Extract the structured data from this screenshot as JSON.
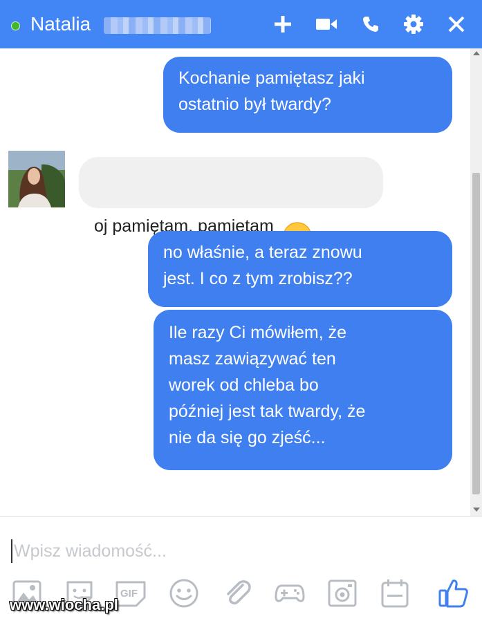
{
  "header": {
    "contact_name": "Natalia",
    "status": "online",
    "accent_color": "#4285f4",
    "icons": [
      "add-icon",
      "video-call-icon",
      "phone-icon",
      "gear-icon",
      "close-icon"
    ]
  },
  "messages": [
    {
      "direction": "outgoing",
      "text": "Kochanie pamiętasz jaki\nostatnio był twardy?"
    },
    {
      "direction": "incoming",
      "text": "oj pamiętam, pamiętam",
      "emoji": "smiling-face"
    },
    {
      "direction": "outgoing",
      "text": "no właśnie, a teraz znowu\njest. I co z tym zrobisz??"
    },
    {
      "direction": "outgoing",
      "text": "Ile razy Ci mówiłem, że\nmasz zawiązywać ten\nworek od chleba bo\npóźniej jest tak twardy, że\nnie da się go zjeść..."
    }
  ],
  "composer": {
    "placeholder": "Wpisz wiadomość...",
    "value": ""
  },
  "toolbar": {
    "icons": [
      "image-icon",
      "sticker-icon",
      "gif-icon",
      "emoji-icon",
      "attachment-icon",
      "game-icon",
      "camera-icon",
      "calendar-icon",
      "like-icon"
    ],
    "gif_label": "GIF"
  },
  "watermark": "www.wiocha.pl"
}
